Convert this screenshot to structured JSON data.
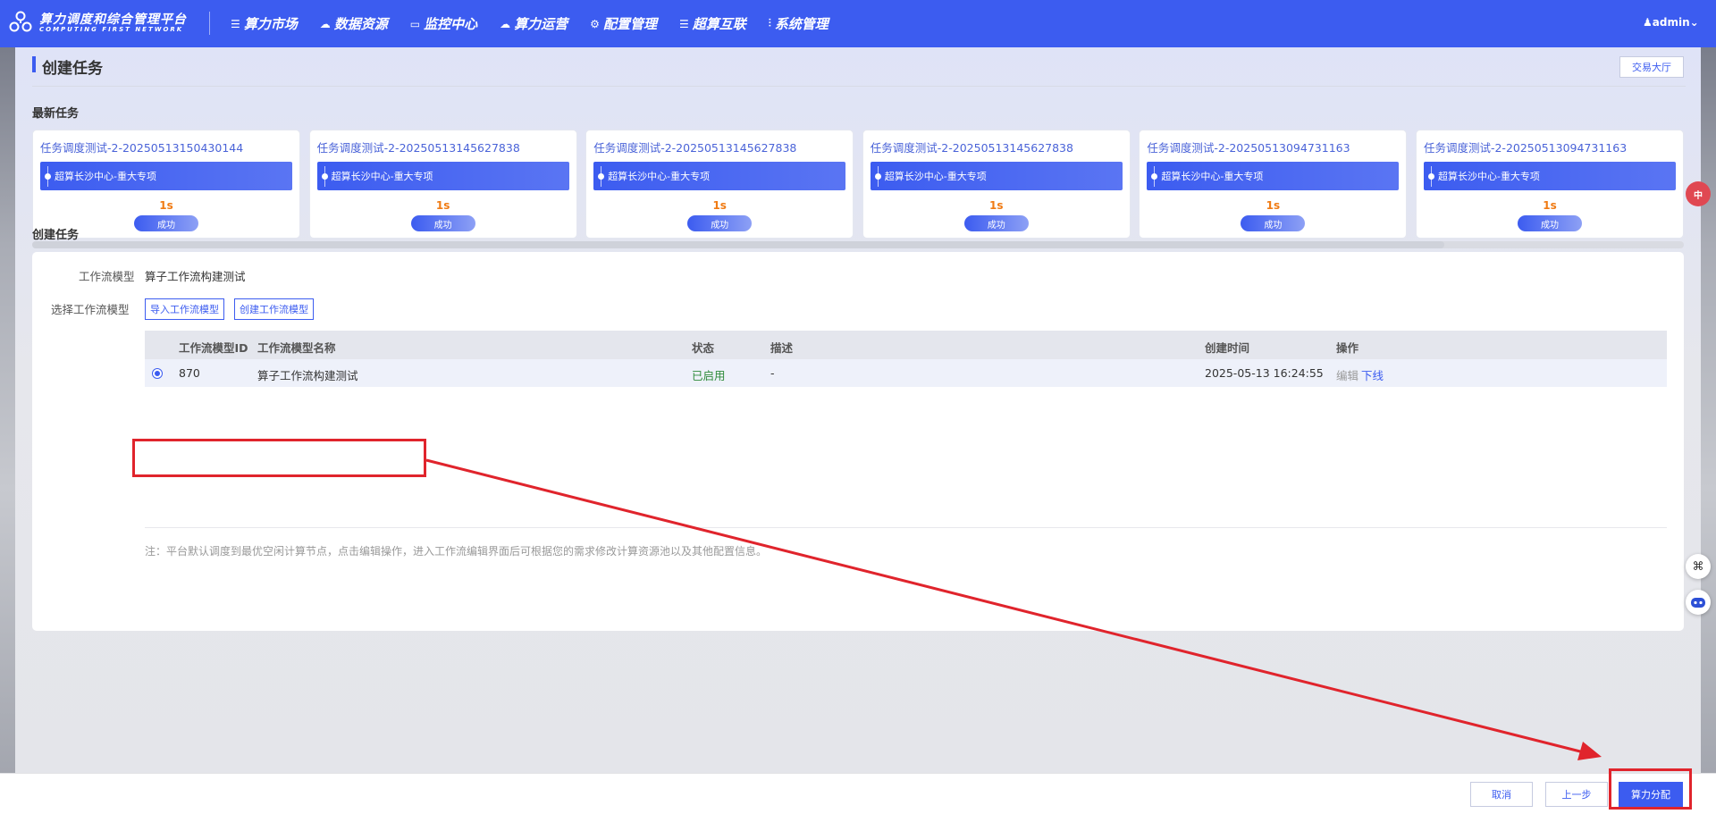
{
  "nav": {
    "brand_title": "算力调度和综合管理平台",
    "brand_subtitle": "COMPUTING FIRST NETWORK",
    "items": [
      {
        "icon": "list-icon",
        "glyph": "☰",
        "label": "算力市场"
      },
      {
        "icon": "cloud-icon",
        "glyph": "☁",
        "label": "数据资源"
      },
      {
        "icon": "monitor-icon",
        "glyph": "▭",
        "label": "监控中心"
      },
      {
        "icon": "cloud-ops-icon",
        "glyph": "☁",
        "label": "算力运营"
      },
      {
        "icon": "gear-icon",
        "glyph": "⚙",
        "label": "配置管理"
      },
      {
        "icon": "list-icon",
        "glyph": "☰",
        "label": "超算互联"
      },
      {
        "icon": "sliders-icon",
        "glyph": "⫶",
        "label": "系统管理"
      }
    ],
    "user": "admin"
  },
  "page": {
    "title": "创建任务",
    "hall_button": "交易大厅"
  },
  "recent": {
    "section_title": "最新任务",
    "cards": [
      {
        "title": "任务调度测试-2-20250513150430144",
        "route": "超算长沙中心-重大专项",
        "duration": "1s",
        "status": "成功"
      },
      {
        "title": "任务调度测试-2-20250513145627838",
        "route": "超算长沙中心-重大专项",
        "duration": "1s",
        "status": "成功"
      },
      {
        "title": "任务调度测试-2-20250513145627838",
        "route": "超算长沙中心-重大专项",
        "duration": "1s",
        "status": "成功"
      },
      {
        "title": "任务调度测试-2-20250513145627838",
        "route": "超算长沙中心-重大专项",
        "duration": "1s",
        "status": "成功"
      },
      {
        "title": "任务调度测试-2-20250513094731163",
        "route": "超算长沙中心-重大专项",
        "duration": "1s",
        "status": "成功"
      },
      {
        "title": "任务调度测试-2-20250513094731163",
        "route": "超算长沙中心-重大专项",
        "duration": "1s",
        "status": "成功"
      }
    ]
  },
  "create": {
    "section_title": "创建任务",
    "workflow_label": "工作流模型",
    "workflow_value": "算子工作流构建测试",
    "select_label": "选择工作流模型",
    "import_button": "导入工作流模型",
    "create_button": "创建工作流模型",
    "table": {
      "headers": {
        "id": "工作流模型ID",
        "name": "工作流模型名称",
        "status": "状态",
        "desc": "描述",
        "created": "创建时间",
        "ops": "操作"
      },
      "rows": [
        {
          "selected": true,
          "id": "870",
          "name": "算子工作流构建测试",
          "status": "已启用",
          "desc": "-",
          "created": "2025-05-13 16:24:55",
          "edit": "编辑",
          "offline": "下线"
        }
      ]
    },
    "note": "注：平台默认调度到最优空闲计算节点，点击编辑操作，进入工作流编辑界面后可根据您的需求修改计算资源池以及其他配置信息。"
  },
  "footer": {
    "cancel": "取消",
    "prev": "上一步",
    "allocate": "算力分配"
  },
  "floating": {
    "lang": "中"
  },
  "colors": {
    "primary": "#3c5cf0",
    "enabled": "#2e8b3a",
    "duration": "#f07b14",
    "annotation": "#e0242c"
  }
}
